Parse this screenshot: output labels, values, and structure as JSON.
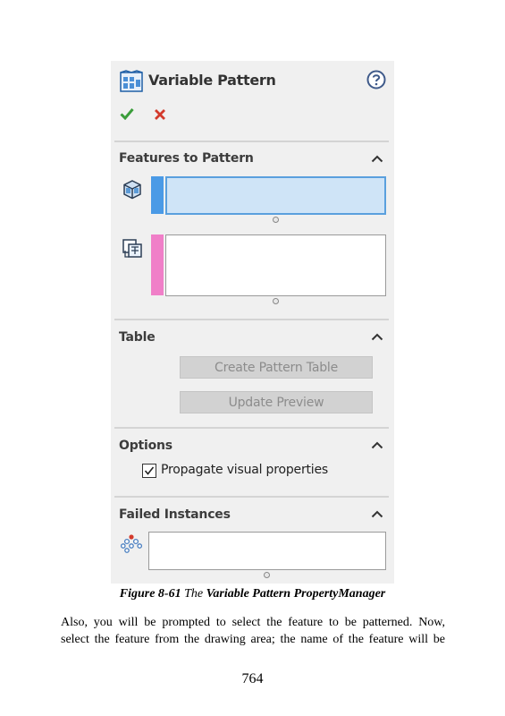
{
  "panel": {
    "title": "Variable Pattern",
    "icons": {
      "title": "variable-pattern-icon",
      "help": "help-icon",
      "ok": "checkmark-icon",
      "cancel": "close-icon"
    },
    "sections": {
      "features": {
        "title": "Features to Pattern",
        "feature_icon": "feature-cube-icon",
        "dimension_icon": "dimension-select-icon"
      },
      "table": {
        "title": "Table",
        "create_button": "Create Pattern Table",
        "update_button": "Update Preview"
      },
      "options": {
        "title": "Options",
        "propagate_label": "Propagate visual properties",
        "propagate_checked": true
      },
      "failed": {
        "title": "Failed Instances",
        "icon": "instances-icon"
      }
    }
  },
  "caption": {
    "label": "Figure 8-61",
    "the": "The",
    "name": "Variable Pattern PropertyManager"
  },
  "body": {
    "line1": "Also, you will be prompted to select the feature to be patterned. Now,",
    "line2": "select the feature from the drawing area; the name of the feature will be"
  },
  "page_number": "764",
  "colors": {
    "accent_blue": "#5aa0de",
    "pink_strip": "#f07fc8",
    "blue_strip": "#4a9ae6",
    "ok_green": "#3a9d3a",
    "cancel_red": "#d33a2c"
  }
}
